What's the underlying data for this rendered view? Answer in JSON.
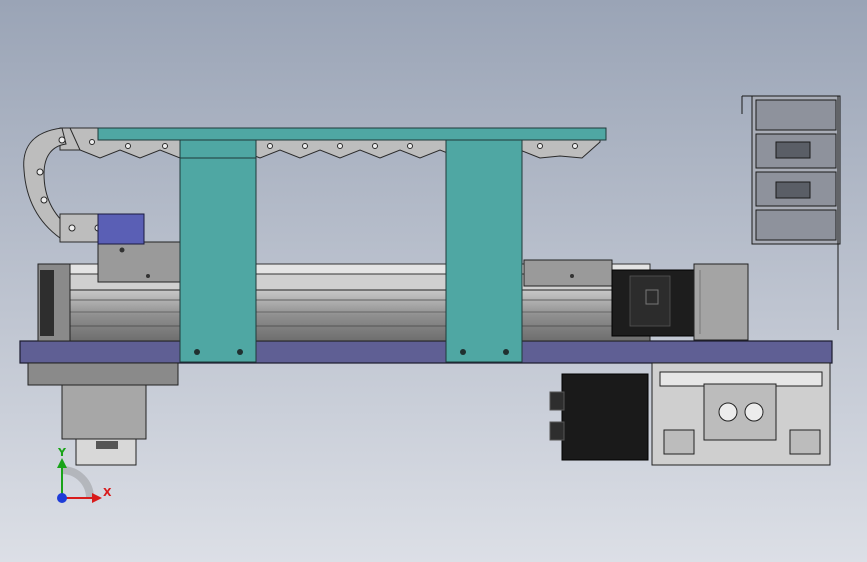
{
  "view": {
    "background_top": "#9aa4b6",
    "background_bottom": "#dcdfe6",
    "axis_triad": {
      "x_label": "X",
      "y_label": "Y",
      "x_color": "#d81b1b",
      "y_color": "#19a319",
      "origin_color": "#1e3cd8"
    }
  },
  "colors": {
    "teal_frame": "#4fa7a3",
    "base_plate": "#5f5f94",
    "cable_chain": "#b9b9b9",
    "motor_dark": "#1e1e1e",
    "rail_gray": "#9d9d9d"
  }
}
